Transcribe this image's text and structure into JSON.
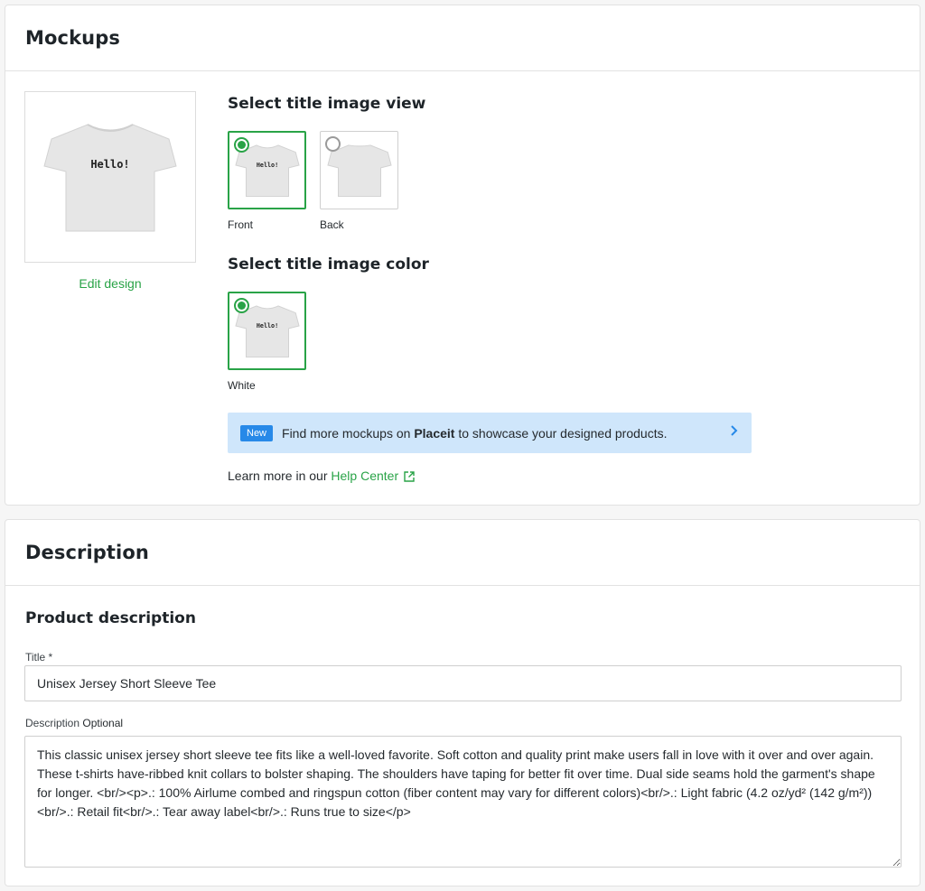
{
  "mockups": {
    "title": "Mockups",
    "preview": {
      "print_text": "Hello!"
    },
    "edit_design": "Edit design",
    "view_section_title": "Select title image view",
    "views": [
      {
        "label": "Front",
        "selected": true
      },
      {
        "label": "Back",
        "selected": false
      }
    ],
    "color_section_title": "Select title image color",
    "colors": [
      {
        "label": "White",
        "selected": true
      }
    ],
    "banner": {
      "badge": "New",
      "text_before": "Find more mockups on ",
      "text_bold": "Placeit",
      "text_after": " to showcase your designed products.",
      "chevron_icon": "chevron-right-icon"
    },
    "learn_more": {
      "prefix": "Learn more in our ",
      "link": "Help Center",
      "icon": "external-link-icon"
    }
  },
  "description": {
    "title": "Description",
    "subtitle": "Product description",
    "title_field": {
      "label": "Title *",
      "value": "Unisex Jersey Short Sleeve Tee"
    },
    "description_field": {
      "label": "Description",
      "label_optional": "Optional",
      "value": "This classic unisex jersey short sleeve tee fits like a well-loved favorite. Soft cotton and quality print make users fall in love with it over and over again. These t-shirts have-ribbed knit collars to bolster shaping. The shoulders have taping for better fit over time. Dual side seams hold the garment's shape for longer. <br/><p>.: 100% Airlume combed and ringspun cotton (fiber content may vary for different colors)<br/>.: Light fabric (4.2 oz/yd² (142 g/m²))<br/>.: Retail fit<br/>.: Tear away label<br/>.: Runs true to size</p>"
    }
  },
  "colors": {
    "accent_green": "#29a347",
    "banner_bg": "#cfe6fb",
    "badge_blue": "#2789e8",
    "border": "#e2e2e2"
  }
}
